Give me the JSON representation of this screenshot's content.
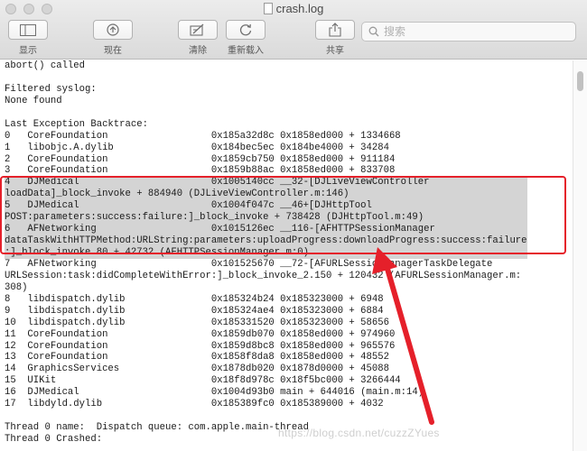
{
  "window": {
    "title": "crash.log"
  },
  "toolbar": {
    "show_label": "显示",
    "now_label": "现在",
    "clear_label": "清除",
    "reload_label": "重新载入",
    "share_label": "共享"
  },
  "search": {
    "placeholder": "搜索",
    "value": ""
  },
  "log": {
    "lines": [
      "abort() called",
      "",
      "Filtered syslog:",
      "None found",
      "",
      "Last Exception Backtrace:",
      "0   CoreFoundation                  0x185a32d8c 0x1858ed000 + 1334668",
      "1   libobjc.A.dylib                 0x184bec5ec 0x184be4000 + 34284",
      "2   CoreFoundation                  0x1859cb750 0x1858ed000 + 911184",
      "3   CoreFoundation                  0x1859b88ac 0x1858ed000 + 833708",
      "4   DJMedical                       0x1005140cc __32-[DJLiveViewController",
      "loadData]_block_invoke + 884940 (DJLiveViewController.m:146)",
      "5   DJMedical                       0x1004f047c __46+[DJHttpTool",
      "POST:parameters:success:failure:]_block_invoke + 738428 (DJHttpTool.m:49)",
      "6   AFNetworking                    0x1015126ec __116-[AFHTTPSessionManager",
      "dataTaskWithHTTPMethod:URLString:parameters:uploadProgress:downloadProgress:success:failure",
      ":]_block_invoke.80 + 42732 (AFHTTPSessionManager.m:0)",
      "7   AFNetworking                    0x101525670 __72-[AFURLSessionManagerTaskDelegate",
      "URLSession:task:didCompleteWithError:]_block_invoke_2.150 + 120432 (AFURLSessionManager.m:",
      "308)",
      "8   libdispatch.dylib               0x185324b24 0x185323000 + 6948",
      "9   libdispatch.dylib               0x185324ae4 0x185323000 + 6884",
      "10  libdispatch.dylib               0x185331520 0x185323000 + 58656",
      "11  CoreFoundation                  0x1859db070 0x1858ed000 + 974960",
      "12  CoreFoundation                  0x1859d8bc8 0x1858ed000 + 965576",
      "13  CoreFoundation                  0x1858f8da8 0x1858ed000 + 48552",
      "14  GraphicsServices                0x1878db020 0x1878d0000 + 45088",
      "15  UIKit                           0x18f8d978c 0x18f5bc000 + 3266444",
      "16  DJMedical                       0x1004d93b0 main + 644016 (main.m:14)",
      "17  libdyld.dylib                   0x185389fc0 0x185389000 + 4032",
      "",
      "Thread 0 name:  Dispatch queue: com.apple.main-thread",
      "Thread 0 Crashed:"
    ]
  },
  "watermark": "https://blog.csdn.net/cuzzZYues",
  "colors": {
    "annotation_red": "#e5202a",
    "selection_gray": "#d4d4d4"
  },
  "icons": [
    "sidebar-icon",
    "target-icon",
    "clear-icon",
    "reload-icon",
    "share-icon",
    "search-icon",
    "document-icon"
  ]
}
